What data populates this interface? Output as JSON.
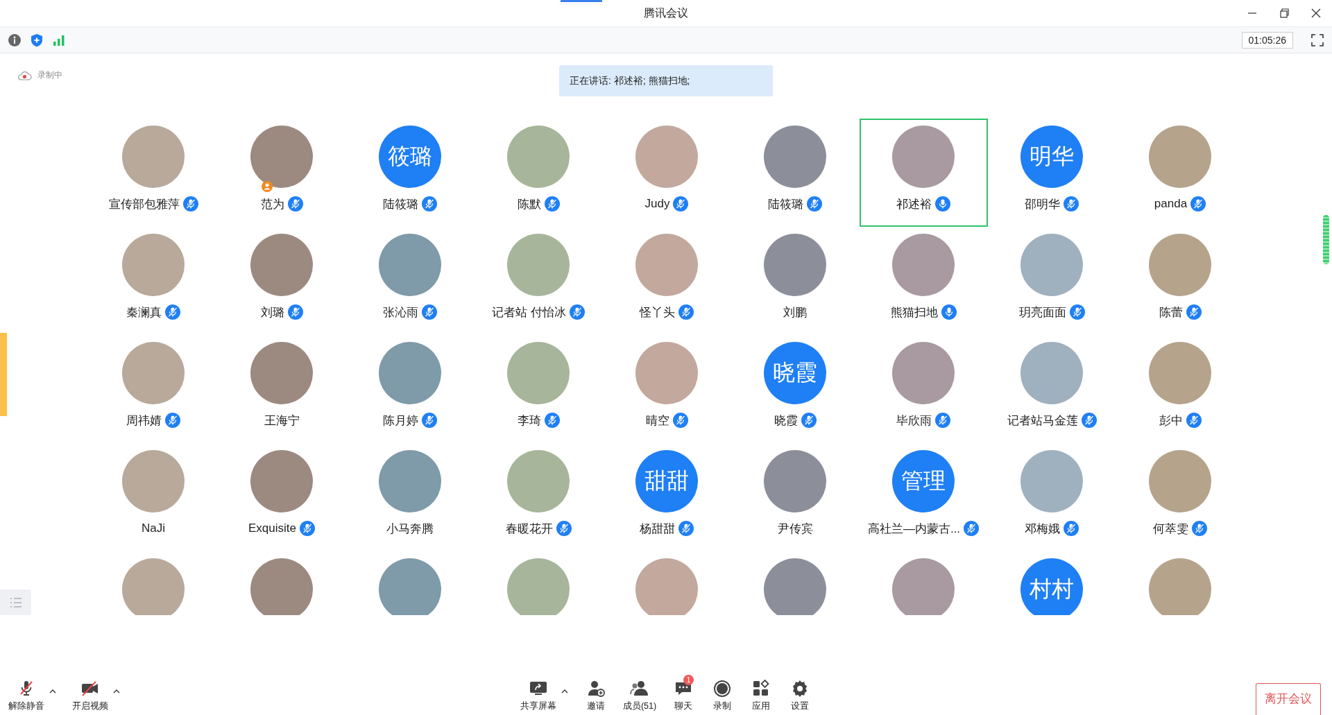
{
  "window": {
    "title": "腾讯会议"
  },
  "toolbar": {
    "timer": "01:05:26"
  },
  "recording": {
    "label": "录制中"
  },
  "speaking_banner": {
    "text": "正在讲话: 祁述裕; 熊猫扫地;"
  },
  "members": [
    {
      "name": "宣传部包雅萍",
      "avatar": {
        "kind": "photo"
      },
      "mic": {
        "muted": true
      },
      "active": false,
      "host": false
    },
    {
      "name": "范为",
      "avatar": {
        "kind": "photo"
      },
      "mic": {
        "muted": true
      },
      "active": false,
      "host": true
    },
    {
      "name": "陆筱璐",
      "avatar": {
        "kind": "text",
        "text": "筱璐"
      },
      "mic": {
        "muted": true
      },
      "active": false,
      "host": false
    },
    {
      "name": "陈默",
      "avatar": {
        "kind": "photo"
      },
      "mic": {
        "muted": true
      },
      "active": false,
      "host": false
    },
    {
      "name": "Judy",
      "avatar": {
        "kind": "photo"
      },
      "mic": {
        "muted": true
      },
      "active": false,
      "host": false
    },
    {
      "name": "陆筱璐",
      "avatar": {
        "kind": "photo"
      },
      "mic": {
        "muted": true
      },
      "active": false,
      "host": false
    },
    {
      "name": "祁述裕",
      "avatar": {
        "kind": "photo"
      },
      "mic": {
        "muted": false
      },
      "active": true,
      "host": false
    },
    {
      "name": "邵明华",
      "avatar": {
        "kind": "text",
        "text": "明华"
      },
      "mic": {
        "muted": true
      },
      "active": false,
      "host": false
    },
    {
      "name": "panda",
      "avatar": {
        "kind": "photo"
      },
      "mic": {
        "muted": true
      },
      "active": false,
      "host": false
    },
    {
      "name": "秦澜真",
      "avatar": {
        "kind": "photo"
      },
      "mic": {
        "muted": true
      },
      "active": false,
      "host": false
    },
    {
      "name": "刘璐",
      "avatar": {
        "kind": "photo"
      },
      "mic": {
        "muted": true
      },
      "active": false,
      "host": false
    },
    {
      "name": "张沁雨",
      "avatar": {
        "kind": "photo"
      },
      "mic": {
        "muted": true
      },
      "active": false,
      "host": false
    },
    {
      "name": "记者站 付怡冰",
      "avatar": {
        "kind": "photo"
      },
      "mic": {
        "muted": true
      },
      "active": false,
      "host": false
    },
    {
      "name": "怪丫头",
      "avatar": {
        "kind": "photo"
      },
      "mic": {
        "muted": true
      },
      "active": false,
      "host": false
    },
    {
      "name": "刘鹏",
      "avatar": {
        "kind": "photo"
      },
      "active": false,
      "host": false
    },
    {
      "name": "熊猫扫地",
      "avatar": {
        "kind": "photo"
      },
      "mic": {
        "muted": false
      },
      "active": false,
      "host": false
    },
    {
      "name": "玥亮面面",
      "avatar": {
        "kind": "photo"
      },
      "mic": {
        "muted": true
      },
      "active": false,
      "host": false
    },
    {
      "name": "陈蕾",
      "avatar": {
        "kind": "photo"
      },
      "mic": {
        "muted": true
      },
      "active": false,
      "host": false
    },
    {
      "name": "周祎婧",
      "avatar": {
        "kind": "photo"
      },
      "mic": {
        "muted": true
      },
      "active": false,
      "host": false
    },
    {
      "name": "王海宁",
      "avatar": {
        "kind": "photo"
      },
      "active": false,
      "host": false
    },
    {
      "name": "陈月婷",
      "avatar": {
        "kind": "photo"
      },
      "mic": {
        "muted": true
      },
      "active": false,
      "host": false
    },
    {
      "name": "李琦",
      "avatar": {
        "kind": "photo"
      },
      "mic": {
        "muted": true
      },
      "active": false,
      "host": false
    },
    {
      "name": "晴空",
      "avatar": {
        "kind": "photo"
      },
      "mic": {
        "muted": true
      },
      "active": false,
      "host": false
    },
    {
      "name": "晓霞",
      "avatar": {
        "kind": "text",
        "text": "晓霞"
      },
      "mic": {
        "muted": true
      },
      "active": false,
      "host": false
    },
    {
      "name": "毕欣雨",
      "avatar": {
        "kind": "photo"
      },
      "mic": {
        "muted": true
      },
      "active": false,
      "host": false
    },
    {
      "name": "记者站马金莲",
      "avatar": {
        "kind": "photo"
      },
      "mic": {
        "muted": true
      },
      "active": false,
      "host": false
    },
    {
      "name": "彭中",
      "avatar": {
        "kind": "photo"
      },
      "mic": {
        "muted": true
      },
      "active": false,
      "host": false
    },
    {
      "name": "NaJi",
      "avatar": {
        "kind": "photo"
      },
      "active": false,
      "host": false
    },
    {
      "name": "Exquisite",
      "avatar": {
        "kind": "photo"
      },
      "mic": {
        "muted": true
      },
      "active": false,
      "host": false
    },
    {
      "name": "小马奔腾",
      "avatar": {
        "kind": "photo"
      },
      "active": false,
      "host": false
    },
    {
      "name": "春暖花开",
      "avatar": {
        "kind": "photo"
      },
      "mic": {
        "muted": true
      },
      "active": false,
      "host": false
    },
    {
      "name": "杨甜甜",
      "avatar": {
        "kind": "text",
        "text": "甜甜"
      },
      "mic": {
        "muted": true
      },
      "active": false,
      "host": false
    },
    {
      "name": "尹传宾",
      "avatar": {
        "kind": "photo"
      },
      "active": false,
      "host": false
    },
    {
      "name": "高社兰—内蒙古...",
      "avatar": {
        "kind": "text",
        "text": "管理"
      },
      "mic": {
        "muted": true
      },
      "active": false,
      "host": false
    },
    {
      "name": "邓梅娥",
      "avatar": {
        "kind": "photo"
      },
      "mic": {
        "muted": true
      },
      "active": false,
      "host": false
    },
    {
      "name": "何萃雯",
      "avatar": {
        "kind": "photo"
      },
      "mic": {
        "muted": true
      },
      "active": false,
      "host": false
    },
    {
      "avatar": {
        "kind": "photo"
      },
      "active": false,
      "host": false
    },
    {
      "avatar": {
        "kind": "photo"
      },
      "active": false,
      "host": false
    },
    {
      "avatar": {
        "kind": "photo"
      },
      "active": false,
      "host": false
    },
    {
      "avatar": {
        "kind": "photo"
      },
      "active": false,
      "host": false
    },
    {
      "avatar": {
        "kind": "photo"
      },
      "active": false,
      "host": false
    },
    {
      "avatar": {
        "kind": "photo"
      },
      "active": false,
      "host": false
    },
    {
      "avatar": {
        "kind": "photo"
      },
      "active": false,
      "host": false
    },
    {
      "avatar": {
        "kind": "text",
        "text": "村村"
      },
      "active": false,
      "host": false
    },
    {
      "avatar": {
        "kind": "photo"
      },
      "active": false,
      "host": false
    }
  ],
  "bottom_bar": {
    "left": [
      {
        "kind": "mic",
        "label": "解除静音",
        "menu": true
      },
      {
        "kind": "camera",
        "label": "开启视频",
        "menu": true
      }
    ],
    "center": [
      {
        "kind": "share",
        "label": "共享屏幕",
        "menu": true
      },
      {
        "kind": "invite",
        "label": "邀请",
        "menu": false
      },
      {
        "kind": "members",
        "label": "成员(51)",
        "menu": false
      },
      {
        "kind": "chat",
        "label": "聊天",
        "menu": false,
        "badge": "1"
      },
      {
        "kind": "record",
        "label": "录制",
        "menu": false
      },
      {
        "kind": "apps",
        "label": "应用",
        "menu": false
      },
      {
        "kind": "settings",
        "label": "设置",
        "menu": false
      }
    ],
    "leave_button": "离开会议"
  }
}
